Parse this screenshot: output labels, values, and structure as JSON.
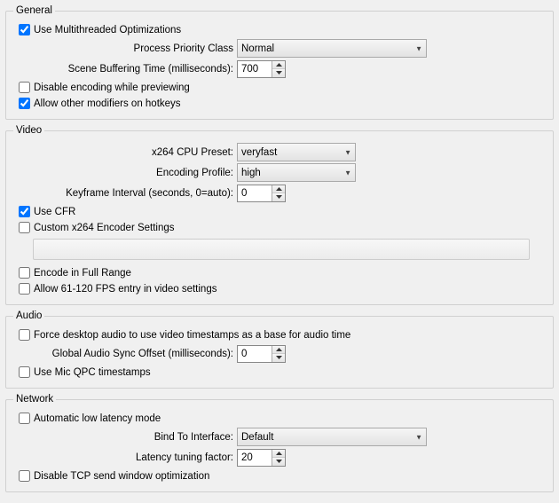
{
  "general": {
    "legend": "General",
    "use_multithreaded": {
      "label": "Use Multithreaded Optimizations",
      "checked": true
    },
    "priority_label": "Process Priority Class",
    "priority_value": "Normal",
    "buffering_label": "Scene Buffering Time (milliseconds):",
    "buffering_value": "700",
    "disable_encoding": {
      "label": "Disable encoding while previewing",
      "checked": false
    },
    "allow_modifiers": {
      "label": "Allow other modifiers on hotkeys",
      "checked": true
    }
  },
  "video": {
    "legend": "Video",
    "preset_label": "x264 CPU Preset:",
    "preset_value": "veryfast",
    "profile_label": "Encoding Profile:",
    "profile_value": "high",
    "keyframe_label": "Keyframe Interval (seconds, 0=auto):",
    "keyframe_value": "0",
    "use_cfr": {
      "label": "Use CFR",
      "checked": true
    },
    "custom_x264": {
      "label": "Custom x264 Encoder Settings",
      "checked": false
    },
    "full_range": {
      "label": "Encode in Full Range",
      "checked": false
    },
    "allow_61_120": {
      "label": "Allow 61-120 FPS entry in video settings",
      "checked": false
    }
  },
  "audio": {
    "legend": "Audio",
    "force_desktop": {
      "label": "Force desktop audio to use video timestamps as a base for audio time",
      "checked": false
    },
    "sync_label": "Global Audio Sync Offset (milliseconds):",
    "sync_value": "0",
    "mic_qpc": {
      "label": "Use Mic QPC timestamps",
      "checked": false
    }
  },
  "network": {
    "legend": "Network",
    "auto_low_latency": {
      "label": "Automatic low latency mode",
      "checked": false
    },
    "bind_label": "Bind To Interface:",
    "bind_value": "Default",
    "latency_label": "Latency tuning factor:",
    "latency_value": "20",
    "disable_tcp": {
      "label": "Disable TCP send window optimization",
      "checked": false
    }
  }
}
